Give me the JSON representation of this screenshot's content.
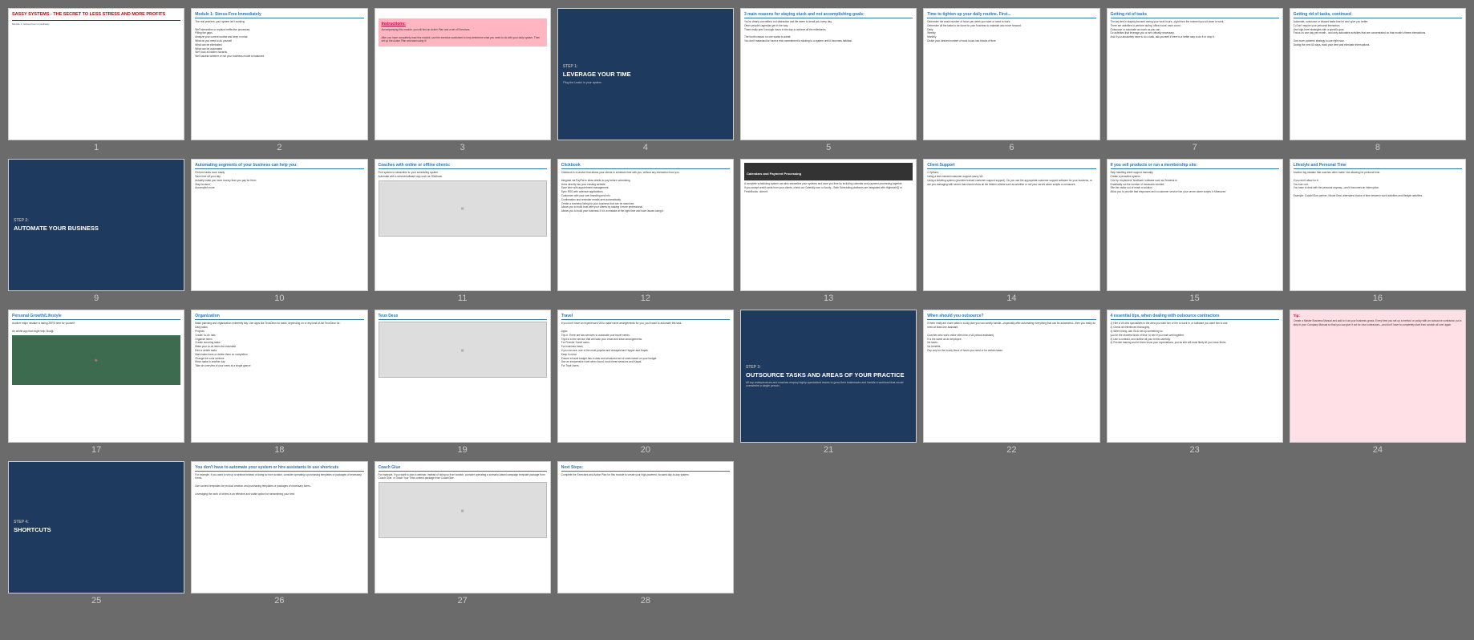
{
  "slides": [
    {
      "id": 1,
      "type": "step",
      "stepLabel": "",
      "title": "SASSY SYSTEMS - THE SECRET TO LESS STRESS AND MORE PROFITS",
      "subtitle": "Module 1: Stress-Free Immediately",
      "number": "1"
    },
    {
      "id": 2,
      "type": "content",
      "title": "Module 1: Stress-Free Immediately",
      "body": "The real problem: your system isn't working.\n\nWe'll streamline or replace ineffective processes.\nFilling the gaps.\nAnalyze your current routine and keep in mind:\nWhat do you need to do yourself\nWhat can be eliminated\nWhat can be automated\nWe'll look at hidden hazards.\nWe'll assess whether or not your business model is balanced.",
      "number": "2"
    },
    {
      "id": 3,
      "type": "pink-instructions",
      "title": "Instructions:",
      "body": "Accompanying this module, you will find an Action Plan and a set of Exercises.\n\nAfter you have completely read this module, use the exercise worksheet to help determine what you need to do with your daily system. Then set up the Action Plan and start using it!",
      "number": "3"
    },
    {
      "id": 4,
      "type": "step",
      "stepLabel": "STEP 1:",
      "title": "LEVERAGE YOUR TIME",
      "subtitle": "'Plug the Leaks' in your system",
      "number": "4"
    },
    {
      "id": 5,
      "type": "content",
      "title": "3 main reasons for staying stuck and not accomplishing goals:",
      "body": "You're clearly committed, but distraction and life seem to derail you every day.\nOther people's agendas get in the way.\nThere really aren't enough hours in the day to achieve all the milestones.\n\nThe fourth reason no one wants to admit:\nYou don't make/and/or have a real commitment to sticking to a system until it becomes habitual.",
      "number": "5"
    },
    {
      "id": 6,
      "type": "content",
      "title": "Time to tighten up your daily routine. First...",
      "body": "Determine the exact number of hours per week you want or need to work.\nDetermine all the tasks to be done for your business to maintain and move forward:\nDaily\nWeekly\nMonthly\nDivide your desired number of work hours into blocks of time.",
      "number": "6"
    },
    {
      "id": 7,
      "type": "content",
      "title": "Getting rid of tasks",
      "body": "The key lies in staying focused during your work hours—right from the moment you sit down to work.\nThere are activities to perform during 'office hours' each count.\nOutsource or automate as much as you can.\nDo activities that leverage you or are critically necessary.\nAnd if you absolutely have to do a task, ask yourself if there is a better way to do it or drop it.",
      "number": "7"
    },
    {
      "id": 8,
      "type": "content",
      "title": "Getting rid of tasks, continued",
      "body": "Automate, outsource or discard tasks that let don't give you better.\n1) Don't require your personal interaction.\nUse high-level strategies with a specific goal.\nFocus on one day per month - and only actionable activities that are concentrated on that month's theme interactions.\n\nOne more powerful strategy to use right now:\nDuring the next 60 days, track your time and eliminate interruptions.",
      "number": "8"
    },
    {
      "id": 9,
      "type": "step",
      "stepLabel": "STEP 2:",
      "title": "AUTOMATE YOUR BUSINESS",
      "subtitle": "",
      "number": "9"
    },
    {
      "id": 10,
      "type": "content",
      "title": "Automating segments of your business can help you:",
      "body": "Perform tasks more easily\nSave time off your day\nActually make you more money than you pay for them\nStay focused\nAccomplish more",
      "number": "10"
    },
    {
      "id": 11,
      "type": "content-image",
      "title": "Coaches with online or offline clients:",
      "body": "First system to streamline is: your scheduling system.\nAutomate with a service/software app such as Clickbook.",
      "hasImage": true,
      "number": "11"
    },
    {
      "id": 12,
      "type": "content",
      "title": "Clickbook",
      "body": "Clickbook is a service that allows your clients to schedule time with you, without any interaction from you.\n\nIntegrate via PayPal to allow clients to pay before scheduling.\nLinks directly into your existing website.\nSave time with appointment management.\nSync RSS with calendar applications.\nCustomize with your own branding and info.\nConfirmation and reminder emails sent automatically.\nCreate a business listing for your business that can be searched.\nAllows you to build trust with your clients by making it more professional.\nAllows you to build your business if it is a mistake at the right time and have issues using it.",
      "number": "12"
    },
    {
      "id": 13,
      "type": "content-pink",
      "title": "Calendars and Payment Processing",
      "body": "A complete scheduling system can also streamline your systems and save you time by including calendar and payment processing together.\nIf you accept credit cards from your clients, check out Calendly.com or Acuity... Both Scheduling platforms are integrated with HighriseHQ or FreshBooks. doesn't.",
      "number": "13"
    },
    {
      "id": 14,
      "type": "content",
      "title": "Client Support",
      "body": "2 Options:\nUsing a tech-minded customer-support-savvy VA.\nUsing a ticketing system (provides trained customer support support). Do you use the appropriate customer support software for your business, or are you managing with server that should show all the hidden criteria such as whether or not your server alone scripts or measures.",
      "number": "14"
    },
    {
      "id": 15,
      "type": "content",
      "title": "If you sell products or run a membership site:",
      "body": "Stop handling client support manually.\nCreate a proactive system.\nOne tip: Implement 'feedback' software such as Zendesk to\nDrastically cut the number of measures needed.\nSite the visitor out of reach a solution.\nAllow you to provide fast responses and a customer service line your server alone scripts 'a Measures'.",
      "hasImage": true,
      "number": "15"
    },
    {
      "id": 16,
      "type": "content",
      "title": "Lifestyle and Personal Time",
      "body": "Another big mistake that coaches often make: Not allowing for personal time.\n\nIf you don't allow for it:\nYou burn out.\nYou have to deal with the personal anyway—and it becomes an interruption.\n\nExample: Coach/Glue partner, Nicole Deal, alternates blocks of time between work activities and lifestyle activities.",
      "number": "16"
    },
    {
      "id": 17,
      "type": "content-image-green",
      "title": "Personal Growth/Lifestyle",
      "body": "Another major mistake is taking ZERO time for yourself.\n\nAn online app that might help: Budgt.",
      "hasImage": true,
      "number": "17"
    },
    {
      "id": 18,
      "type": "content",
      "title": "Organization",
      "body": "Make planning and organization extremely tidy. Use apps like TeuxDeux for tasks, depending on or any-kind-of-list TeuxDeux for:\nDaily tasks\nProjects\nCreate 'to-do' lists\nOrganize items\nCreate recurring tasks\nMake your to-do items list cloneable\nEdit or delete tasks\nMark tasks done or delete them on completion\nChange the color scheme\nMove tasks to another day\nTake an overview of your week at a single glance",
      "number": "18"
    },
    {
      "id": 19,
      "type": "content-image",
      "title": "Teux Deux",
      "body": "",
      "hasImage": true,
      "number": "19"
    },
    {
      "id": 20,
      "type": "content",
      "title": "Travel",
      "body": "If you don't have an experienced VA to make travel arrangements for you, you'll want to automate this task.\n\nApps:\nTrip-it. There are two services to automate your travel needs.\nTripit is a free service that will scan your email and travel arrangements.\nFor Premier Travel users.\nFor business travel.\nIf you can see, one of the most popular and cheapest are Hopper and Kayak.\nKeep in mind:\nEnsure a travel budget has a clear and structured set of costs based on your budget.\nUse an inexpensive hotel when found, book these sessions and Kayak.\nFor Tripit Users.",
      "number": "20"
    },
    {
      "id": 21,
      "type": "step",
      "stepLabel": "STEP 3:",
      "title": "OUTSOURCE TASKS AND AREAS OF YOUR PRACTICE",
      "subtitle": "All top entrepreneurs and coaches employ highly-specialized teams to grow their businesses and handle a workload that would overwhelm a single person.",
      "number": "21"
    },
    {
      "id": 22,
      "type": "content",
      "title": "When should you outsource?",
      "body": "If there really are more tasks in a day plan you can sanely handle—especially after automating everything that can be automated—then you really do need at least one assistant.\n\nCoaches who work online often hire a VA (virtual assistant).\nIt is the same as an employee.\nNo taxes.\nNo benefits.\nPay only for the hourly block of hours you need or for certain tasks.",
      "number": "22"
    },
    {
      "id": 23,
      "type": "content",
      "title": "4 essential tips, when dealing with outsource contractors",
      "body": "1) Hire a VA who specializes in the area you wish him or her to work in, or software you want him to use.\n2) Check all references thoroughly.\n3) When hiring, ask VA to set up something so\nyou for the shortest block of time, to see if you work well together.\n3) Use a contract, and outline all your terms carefully.\n4) Provide training and let them know your expectations, just as she will most likely let you know theirs.",
      "number": "23"
    },
    {
      "id": 24,
      "type": "pink-bg",
      "title": "Tip:",
      "body": "Create a Master Business Manual and add to it as your business grows. Every time you set up a method or policy with an outsource contractor, put a step in your Company Manual so that you can give it out for new contractors—and don't have to completely start from scratch all over again.",
      "number": "24"
    },
    {
      "id": 25,
      "type": "step",
      "stepLabel": "STEP 4:",
      "title": "SHORTCUTS",
      "subtitle": "",
      "number": "25"
    },
    {
      "id": 26,
      "type": "content",
      "title": "You don't have to automate your system or hire assistants to use shortcuts",
      "body": "For example, if you want to set up a webinar instead of doing so from scratch, consider operating a purchasing templates or packages of necessary forms.\n\nUse content templates for product creation and purchasing templates or packages of necessary forms.\n\nLeveraging the work of others is an effective and viable option for streamlining your time.",
      "number": "26"
    },
    {
      "id": 27,
      "type": "content-image",
      "title": "Coach Glue",
      "body": "For example, if you want to plan a webinar, instead of doing so from scratch, consider operating a scenario-based campaign template package from Coach Glue, or Teach Your Tribe content package from CoachGlue.",
      "hasImage": true,
      "number": "27"
    },
    {
      "id": 28,
      "type": "content",
      "title": "Next Steps:",
      "body": "Complete the Exercises and Action Plan for this module to create your high-powered, focused day-to-day system.",
      "number": "28"
    }
  ],
  "colors": {
    "stepBg": "#1e3a5f",
    "titleBlue": "#2e75b6",
    "pinkBg": "#ffe0e6",
    "pinkTitle": "#cc0044",
    "darkBg": "#2c3e50",
    "bodyText": "#333333",
    "slideBackground": "#ffffff",
    "gridBackground": "#6b6b6b",
    "numberColor": "#cccccc"
  }
}
